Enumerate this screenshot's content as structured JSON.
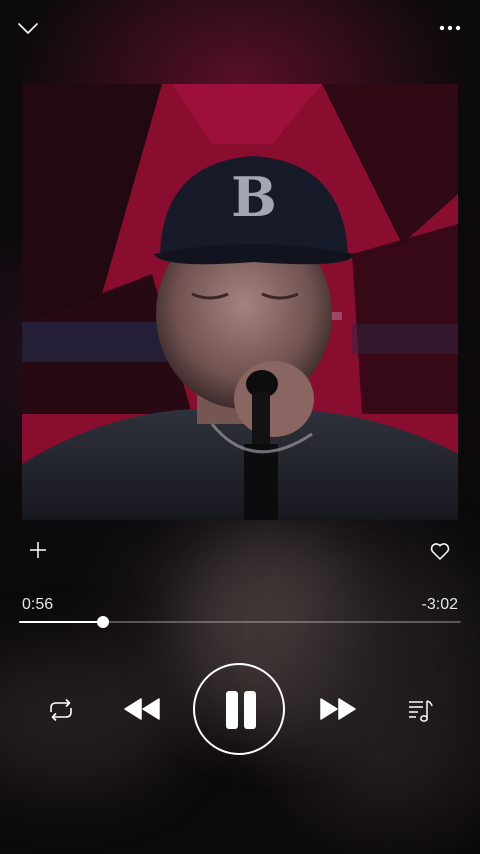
{
  "screen": "now-playing",
  "header": {
    "collapse_icon": "chevron-down-icon",
    "more_icon": "ellipsis-icon"
  },
  "artwork": {
    "description_icon": "album-artwork-image",
    "cap_letter": "B"
  },
  "actions": {
    "add_icon": "plus-icon",
    "favorite_icon": "heart-icon"
  },
  "playback": {
    "elapsed": "0:56",
    "remaining": "-3:02",
    "progress_fraction": 0.19
  },
  "controls": {
    "repeat_icon": "repeat-icon",
    "previous_icon": "rewind-icon",
    "play_pause_icon": "pause-icon",
    "next_icon": "fast-forward-icon",
    "queue_icon": "playlist-icon"
  },
  "colors": {
    "accent": "#ffffff",
    "background": "#0c0a0d",
    "artwork_backdrop": "#a8103a"
  }
}
